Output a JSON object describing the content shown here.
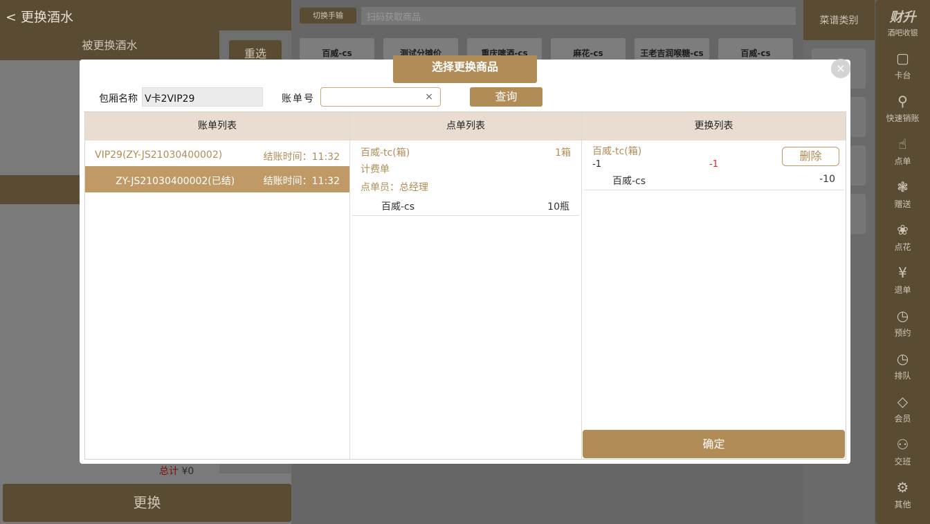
{
  "background": {
    "left": {
      "title": "< 更换酒水",
      "subheader": "被更换酒水",
      "reselect_label": "重选",
      "total_label": "总计",
      "total_value": "¥0",
      "replace_label": "更换"
    },
    "middle": {
      "switch_label": "切换手输",
      "scan_placeholder": "扫码获取商品.",
      "cards": [
        "百威-cs",
        "测试分摊价",
        "重庆啤酒-cs",
        "麻花-cs",
        "王老吉润喉糖-cs",
        "百威-cs"
      ]
    },
    "category": {
      "title": "菜谱类别"
    }
  },
  "sidebar": {
    "brand_main": "财升",
    "brand_sub": "酒吧收银",
    "items": [
      {
        "label": "卡台",
        "icon": "table-icon",
        "glyph": "▢"
      },
      {
        "label": "快速销账",
        "icon": "quick-bill-icon",
        "glyph": "⚲"
      },
      {
        "label": "点单",
        "icon": "order-hand-icon",
        "glyph": "☝"
      },
      {
        "label": "赠送",
        "icon": "gift-icon",
        "glyph": "❃"
      },
      {
        "label": "点花",
        "icon": "flower-icon",
        "glyph": "❀"
      },
      {
        "label": "退单",
        "icon": "refund-icon",
        "glyph": "¥"
      },
      {
        "label": "预约",
        "icon": "clock-icon",
        "glyph": "◷"
      },
      {
        "label": "排队",
        "icon": "queue-icon",
        "glyph": "◷"
      },
      {
        "label": "会员",
        "icon": "diamond-icon",
        "glyph": "◇"
      },
      {
        "label": "交班",
        "icon": "handover-icon",
        "glyph": "⚇"
      },
      {
        "label": "其他",
        "icon": "gear-icon",
        "glyph": "⚙"
      }
    ]
  },
  "modal": {
    "title": "选择更换商品",
    "close_glyph": "×",
    "room_label": "包厢名称",
    "room_value": "V卡2VIP29",
    "bill_label": "账单号",
    "bill_value": "",
    "clear_glyph": "×",
    "query_label": "查询",
    "columns": {
      "bills": "账单列表",
      "orders": "点单列表",
      "replace": "更换列表"
    },
    "bills": [
      {
        "id": "VIP29(ZY-JS21030400002)",
        "time": "结账时间：11:32",
        "selected": false
      },
      {
        "id": "ZY-JS21030400002(已结)",
        "time": "结账时间：11:32",
        "selected": true
      }
    ],
    "orders": {
      "name": "百威-tc(箱)",
      "qty": "1箱",
      "type": "计费单",
      "operator": "点单员：总经理",
      "sub_name": "百威-cs",
      "sub_qty": "10瓶"
    },
    "replace": {
      "name": "百威-tc(箱)",
      "qty_left": "-1",
      "qty_right": "-1",
      "delete_label": "删除",
      "sub_name": "百威-cs",
      "sub_qty": "-10"
    },
    "confirm_label": "确定"
  }
}
